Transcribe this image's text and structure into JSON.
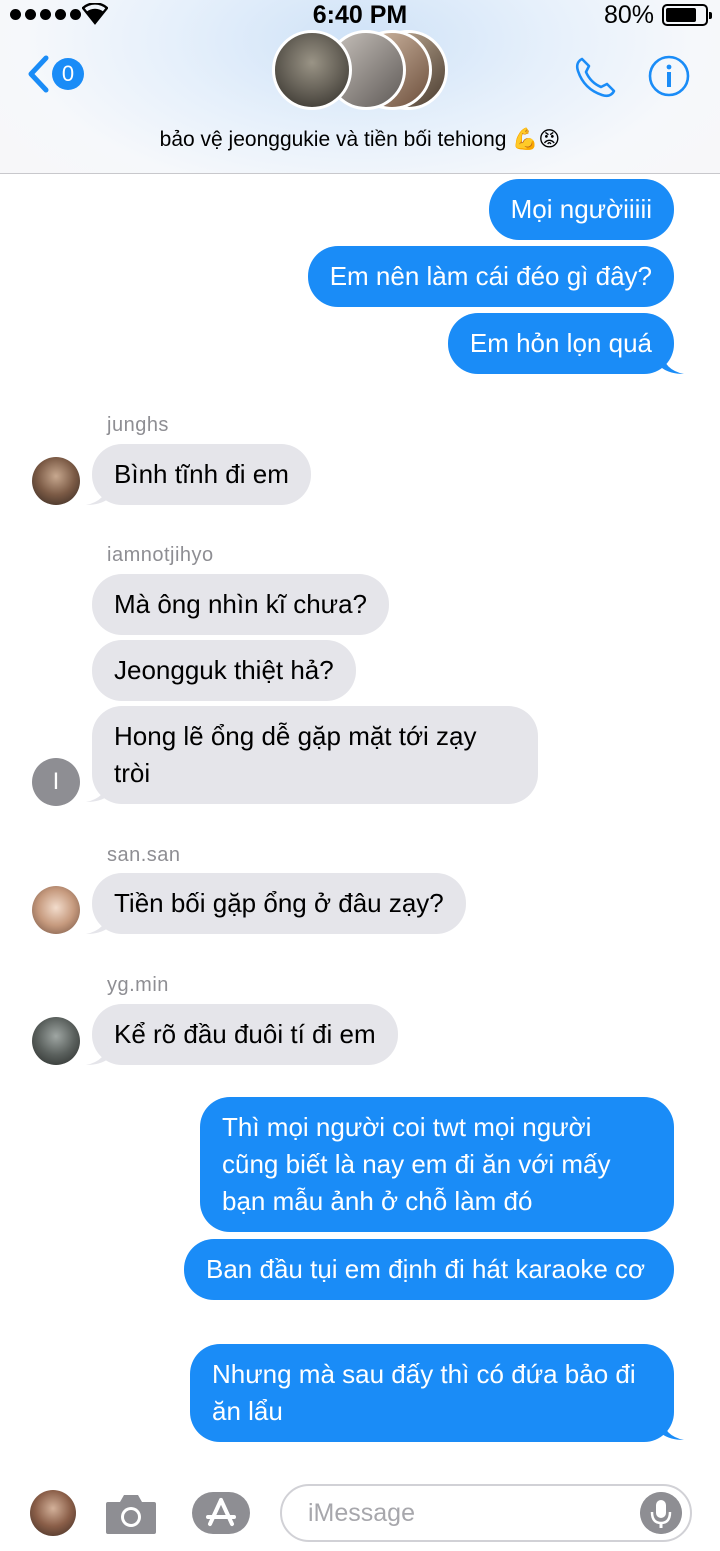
{
  "status_bar": {
    "time": "6:40 PM",
    "battery_percent": "80%",
    "battery_level": 0.8
  },
  "header": {
    "back_count": "0",
    "title": "bảo vệ jeonggukie và tiền bối tehiong 💪😡"
  },
  "messages": [
    {
      "dir": "out",
      "text": "Mọi ngườiiiii"
    },
    {
      "dir": "out",
      "text": "Em nên làm cái đéo gì đây?"
    },
    {
      "dir": "out",
      "text": "Em hỏn lọn quá"
    },
    {
      "sender": "junghs",
      "dir": "in",
      "text": "Bình tĩnh đi em"
    },
    {
      "sender": "iamnotjihyo",
      "dir": "in",
      "text": "Mà ông nhìn kĩ chưa?"
    },
    {
      "dir": "in",
      "text": "Jeongguk thiệt hả?"
    },
    {
      "dir": "in",
      "text": "Hong lẽ ổng dễ gặp mặt tới zạy tròi"
    },
    {
      "sender": "san.san",
      "dir": "in",
      "text": "Tiền bối gặp ổng ở đâu zạy?"
    },
    {
      "sender": "yg.min",
      "dir": "in",
      "text": "Kể rõ đầu đuôi tí đi em"
    },
    {
      "dir": "out",
      "text": "Thì mọi người coi twt mọi người cũng biết là nay em đi ăn với mấy bạn mẫu ảnh ở chỗ làm đó"
    },
    {
      "dir": "out",
      "text": "Ban đầu tụi em định đi hát karaoke cơ"
    },
    {
      "dir": "out",
      "text": "Nhưng mà sau đấy thì có đứa bảo đi ăn lẩu"
    }
  ],
  "avatars": {
    "iamnotjihyo_initial": "I"
  },
  "input": {
    "placeholder": "iMessage"
  },
  "colors": {
    "accent": "#1a8cf7",
    "incoming_bubble": "#e5e5ea",
    "sender_label": "#8e8e93"
  }
}
